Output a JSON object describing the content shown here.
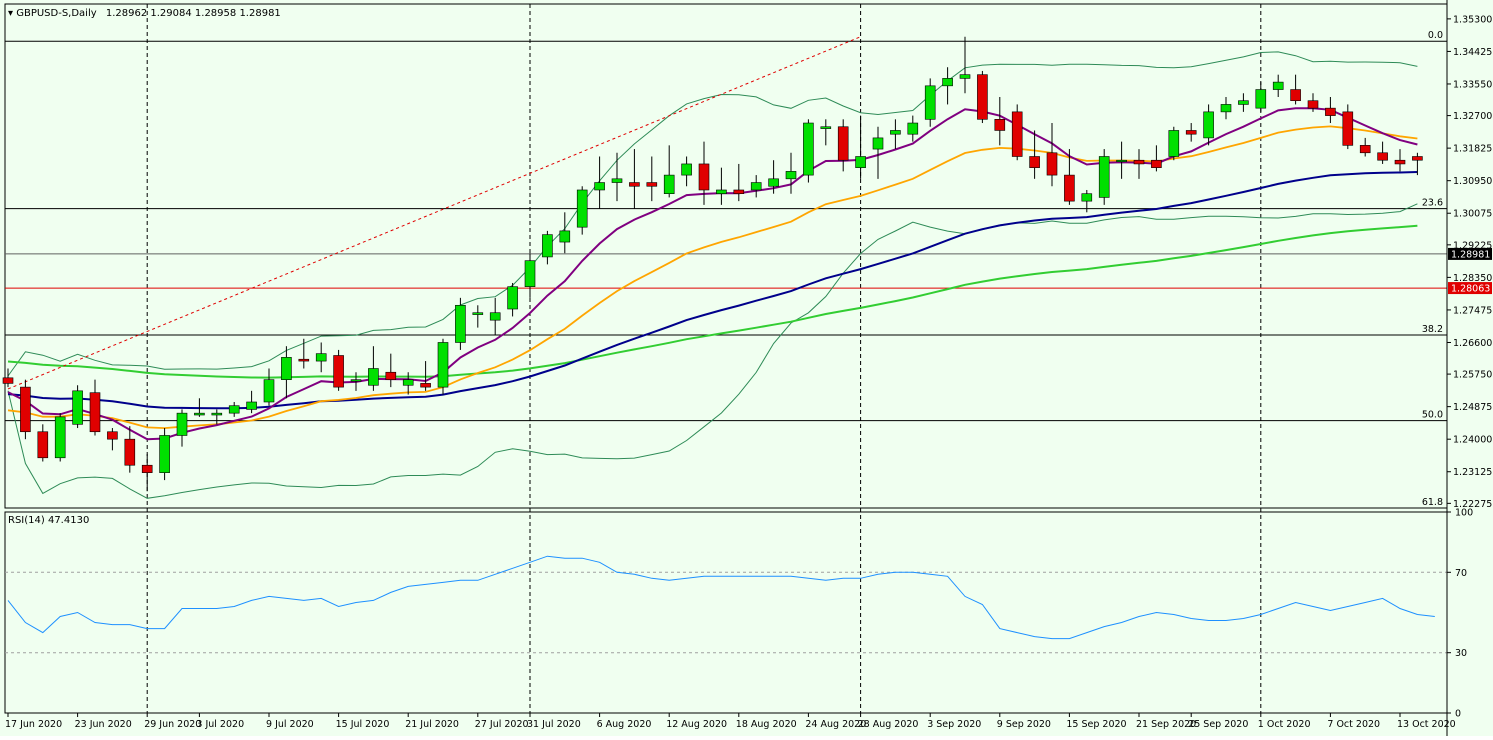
{
  "chart_data": [
    {
      "type": "candlestick",
      "title": "GBPUSD-S,Daily",
      "ohlc_readout": "1.28962 1.29084 1.28958 1.28981",
      "current_price": "1.28981",
      "current_price_value": 1.28981,
      "ylim": [
        1.2215,
        1.357
      ],
      "price_ticks": [
        "1.35300",
        "1.34425",
        "1.33550",
        "1.32700",
        "1.31825",
        "1.30950",
        "1.30075",
        "1.29225",
        "1.28350",
        "1.27475",
        "1.26600",
        "1.25750",
        "1.24875",
        "1.24000",
        "1.23125",
        "1.22275"
      ],
      "horizontal_lines": [
        {
          "label": "0.0",
          "price": 1.347,
          "color": "#000000"
        },
        {
          "label": "23.6",
          "price": 1.302,
          "color": "#000000"
        },
        {
          "label": "",
          "price": 1.28981,
          "color": "#606060"
        },
        {
          "label": "1.28063",
          "price": 1.28063,
          "color": "#e00000"
        },
        {
          "label": "38.2",
          "price": 1.268,
          "color": "#000000"
        },
        {
          "label": "50.0",
          "price": 1.245,
          "color": "#000000"
        },
        {
          "label": "61.8",
          "price": 1.2215,
          "color": "#000000"
        }
      ],
      "x_labels": [
        "17 Jun 2020",
        "23 Jun 2020",
        "29 Jun 2020",
        "3 Jul 2020",
        "9 Jul 2020",
        "15 Jul 2020",
        "21 Jul 2020",
        "27 Jul 2020",
        "31 Jul 2020",
        "6 Aug 2020",
        "12 Aug 2020",
        "18 Aug 2020",
        "24 Aug 2020",
        "28 Aug 2020",
        "3 Sep 2020",
        "9 Sep 2020",
        "15 Sep 2020",
        "21 Sep 2020",
        "25 Sep 2020",
        "1 Oct 2020",
        "7 Oct 2020",
        "13 Oct 2020"
      ],
      "x_label_index": [
        0,
        4,
        8,
        11,
        15,
        19,
        23,
        27,
        30,
        34,
        38,
        42,
        46,
        49,
        53,
        57,
        61,
        65,
        68,
        72,
        76,
        80
      ],
      "vertical_dividers_index": [
        8,
        30,
        49,
        72
      ],
      "trendline": {
        "from": {
          "index": 0,
          "price": 1.2535
        },
        "to": {
          "index": 49,
          "price": 1.3482
        }
      },
      "candles": [
        [
          1.2565,
          1.259,
          1.254,
          1.255
        ],
        [
          1.254,
          1.256,
          1.24,
          1.242
        ],
        [
          1.242,
          1.244,
          1.234,
          1.235
        ],
        [
          1.235,
          1.247,
          1.234,
          1.246
        ],
        [
          1.244,
          1.2545,
          1.243,
          1.253
        ],
        [
          1.2525,
          1.256,
          1.241,
          1.242
        ],
        [
          1.242,
          1.243,
          1.237,
          1.24
        ],
        [
          1.24,
          1.2435,
          1.231,
          1.233
        ],
        [
          1.233,
          1.236,
          1.226,
          1.231
        ],
        [
          1.231,
          1.243,
          1.229,
          1.241
        ],
        [
          1.241,
          1.248,
          1.238,
          1.247
        ],
        [
          1.2465,
          1.251,
          1.246,
          1.247
        ],
        [
          1.2465,
          1.248,
          1.244,
          1.247
        ],
        [
          1.247,
          1.25,
          1.246,
          1.249
        ],
        [
          1.248,
          1.253,
          1.247,
          1.25
        ],
        [
          1.25,
          1.259,
          1.249,
          1.256
        ],
        [
          1.256,
          1.265,
          1.251,
          1.262
        ],
        [
          1.2615,
          1.267,
          1.259,
          1.261
        ],
        [
          1.261,
          1.266,
          1.258,
          1.263
        ],
        [
          1.2625,
          1.264,
          1.253,
          1.254
        ],
        [
          1.256,
          1.258,
          1.253,
          1.256
        ],
        [
          1.2545,
          1.265,
          1.253,
          1.259
        ],
        [
          1.258,
          1.263,
          1.254,
          1.256
        ],
        [
          1.2545,
          1.258,
          1.252,
          1.256
        ],
        [
          1.255,
          1.261,
          1.253,
          1.254
        ],
        [
          1.254,
          1.267,
          1.252,
          1.266
        ],
        [
          1.266,
          1.278,
          1.264,
          1.276
        ],
        [
          1.2735,
          1.276,
          1.27,
          1.274
        ],
        [
          1.272,
          1.278,
          1.268,
          1.274
        ],
        [
          1.275,
          1.282,
          1.273,
          1.281
        ],
        [
          1.281,
          1.29,
          1.278,
          1.288
        ],
        [
          1.289,
          1.296,
          1.287,
          1.295
        ],
        [
          1.293,
          1.301,
          1.29,
          1.296
        ],
        [
          1.297,
          1.308,
          1.295,
          1.307
        ],
        [
          1.307,
          1.316,
          1.302,
          1.309
        ],
        [
          1.309,
          1.317,
          1.304,
          1.31
        ],
        [
          1.309,
          1.318,
          1.302,
          1.308
        ],
        [
          1.309,
          1.316,
          1.304,
          1.308
        ],
        [
          1.306,
          1.319,
          1.305,
          1.311
        ],
        [
          1.311,
          1.316,
          1.308,
          1.314
        ],
        [
          1.314,
          1.32,
          1.303,
          1.307
        ],
        [
          1.306,
          1.313,
          1.303,
          1.307
        ],
        [
          1.307,
          1.314,
          1.304,
          1.306
        ],
        [
          1.307,
          1.311,
          1.305,
          1.309
        ],
        [
          1.308,
          1.315,
          1.306,
          1.31
        ],
        [
          1.31,
          1.317,
          1.306,
          1.312
        ],
        [
          1.311,
          1.326,
          1.309,
          1.325
        ],
        [
          1.3235,
          1.326,
          1.319,
          1.324
        ],
        [
          1.324,
          1.326,
          1.312,
          1.315
        ],
        [
          1.313,
          1.327,
          1.31,
          1.316
        ],
        [
          1.318,
          1.324,
          1.31,
          1.321
        ],
        [
          1.322,
          1.326,
          1.318,
          1.323
        ],
        [
          1.322,
          1.327,
          1.32,
          1.325
        ],
        [
          1.326,
          1.337,
          1.324,
          1.335
        ],
        [
          1.335,
          1.34,
          1.33,
          1.337
        ],
        [
          1.337,
          1.3482,
          1.333,
          1.338
        ],
        [
          1.338,
          1.339,
          1.325,
          1.326
        ],
        [
          1.326,
          1.332,
          1.319,
          1.323
        ],
        [
          1.328,
          1.33,
          1.315,
          1.316
        ],
        [
          1.316,
          1.323,
          1.31,
          1.313
        ],
        [
          1.317,
          1.325,
          1.308,
          1.311
        ],
        [
          1.311,
          1.318,
          1.303,
          1.304
        ],
        [
          1.304,
          1.307,
          1.301,
          1.306
        ],
        [
          1.305,
          1.318,
          1.303,
          1.316
        ],
        [
          1.315,
          1.32,
          1.31,
          1.315
        ],
        [
          1.315,
          1.318,
          1.31,
          1.314
        ],
        [
          1.315,
          1.319,
          1.312,
          1.313
        ],
        [
          1.316,
          1.324,
          1.315,
          1.323
        ],
        [
          1.323,
          1.325,
          1.32,
          1.322
        ],
        [
          1.321,
          1.33,
          1.319,
          1.328
        ],
        [
          1.328,
          1.332,
          1.326,
          1.33
        ],
        [
          1.33,
          1.333,
          1.328,
          1.331
        ],
        [
          1.329,
          1.336,
          1.328,
          1.334
        ],
        [
          1.334,
          1.338,
          1.332,
          1.336
        ],
        [
          1.334,
          1.338,
          1.33,
          1.331
        ],
        [
          1.331,
          1.333,
          1.328,
          1.329
        ],
        [
          1.329,
          1.332,
          1.325,
          1.327
        ],
        [
          1.328,
          1.33,
          1.318,
          1.319
        ],
        [
          1.319,
          1.321,
          1.316,
          1.317
        ],
        [
          1.317,
          1.32,
          1.314,
          1.315
        ],
        [
          1.315,
          1.318,
          1.312,
          1.314
        ],
        [
          1.316,
          1.317,
          1.311,
          1.315
        ]
      ],
      "indicator_labels": [
        "RSI(14) 47.4130"
      ],
      "rsi": {
        "label": "RSI(14) 47.4130",
        "ylim": [
          0,
          100
        ],
        "ticks": [
          100,
          70,
          30,
          0
        ],
        "levels": [
          70,
          30
        ],
        "values": [
          56,
          45,
          40,
          48,
          50,
          45,
          44,
          44,
          42,
          42,
          52,
          52,
          52,
          53,
          56,
          58,
          57,
          56,
          57,
          53,
          55,
          56,
          60,
          63,
          64,
          65,
          66,
          66,
          69,
          72,
          75,
          78,
          77,
          77,
          75,
          70,
          69,
          67,
          66,
          67,
          68,
          68,
          68,
          68,
          68,
          68,
          67,
          66,
          67,
          67,
          69,
          70,
          70,
          69,
          68,
          58,
          54,
          42,
          40,
          38,
          37,
          37,
          40,
          43,
          45,
          48,
          50,
          49,
          47,
          46,
          46,
          47,
          49,
          52,
          55,
          53,
          51,
          53,
          55,
          57,
          52,
          49,
          48
        ]
      },
      "series": [
        {
          "name": "Bollinger upper",
          "color": "#2e8b57"
        },
        {
          "name": "Bollinger middle",
          "color": "#2e8b57"
        },
        {
          "name": "Bollinger lower",
          "color": "#2e8b57"
        },
        {
          "name": "EMA fast",
          "color": "#800080"
        },
        {
          "name": "EMA medium",
          "color": "#ffa500"
        },
        {
          "name": "EMA slow",
          "color": "#00008b"
        },
        {
          "name": "EMA long",
          "color": "#32cd32"
        }
      ]
    }
  ],
  "colors": {
    "bull": "#00e000",
    "bear": "#e00000",
    "background": "#f0fff0",
    "grid": "#000000"
  }
}
